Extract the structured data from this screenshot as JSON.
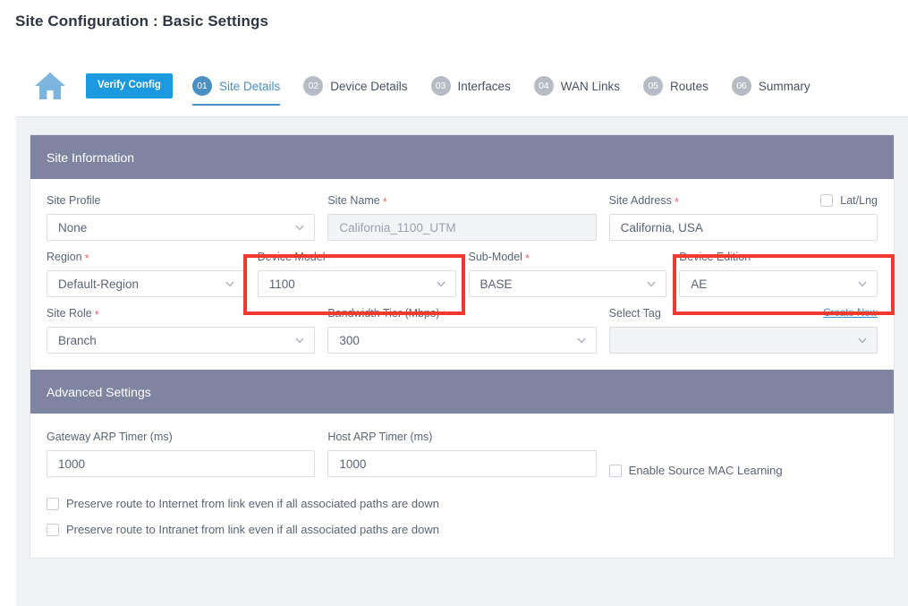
{
  "page_title": "Site Configuration : Basic Settings",
  "wizard": {
    "home_icon": "home-icon",
    "verify_label": "Verify Config",
    "steps": [
      {
        "num": "01",
        "label": "Site Details",
        "active": true
      },
      {
        "num": "02",
        "label": "Device Details",
        "active": false
      },
      {
        "num": "03",
        "label": "Interfaces",
        "active": false
      },
      {
        "num": "04",
        "label": "WAN Links",
        "active": false
      },
      {
        "num": "05",
        "label": "Routes",
        "active": false
      },
      {
        "num": "06",
        "label": "Summary",
        "active": false
      }
    ]
  },
  "site_information": {
    "header": "Site Information",
    "site_profile": {
      "label": "Site Profile",
      "value": "None"
    },
    "site_name": {
      "label": "Site Name",
      "value": "California_1100_UTM",
      "required": true
    },
    "site_address": {
      "label": "Site Address",
      "value": "California, USA",
      "required": true
    },
    "lat_lng": {
      "label": "Lat/Lng",
      "checked": false
    },
    "region": {
      "label": "Region",
      "value": "Default-Region",
      "required": true
    },
    "device_model": {
      "label": "Device Model",
      "value": "1100",
      "required": true
    },
    "sub_model": {
      "label": "Sub-Model",
      "value": "BASE",
      "required": true
    },
    "device_edition": {
      "label": "Device Edition",
      "value": "AE",
      "required": true
    },
    "site_role": {
      "label": "Site Role",
      "value": "Branch",
      "required": true
    },
    "bandwidth_tier": {
      "label": "Bandwidth Tier (Mbps)",
      "value": "300",
      "required": true
    },
    "select_tag": {
      "label": "Select Tag",
      "value": "",
      "create_new": "Create New"
    }
  },
  "advanced_settings": {
    "header": "Advanced Settings",
    "gateway_arp_timer": {
      "label": "Gateway ARP Timer (ms)",
      "value": "1000"
    },
    "host_arp_timer": {
      "label": "Host ARP Timer (ms)",
      "value": "1000"
    },
    "enable_source_mac_learning": {
      "label": "Enable Source MAC Learning",
      "checked": false
    },
    "preserve_internet": {
      "label": "Preserve route to Internet from link even if all associated paths are down",
      "checked": false
    },
    "preserve_intranet": {
      "label": "Preserve route to Intranet from link even if all associated paths are down",
      "checked": false
    }
  },
  "annotations": {
    "accent_color": "#f03a2e",
    "highlight_device_model": "device-model-highlight",
    "highlight_device_edition": "device-edition-highlight"
  }
}
